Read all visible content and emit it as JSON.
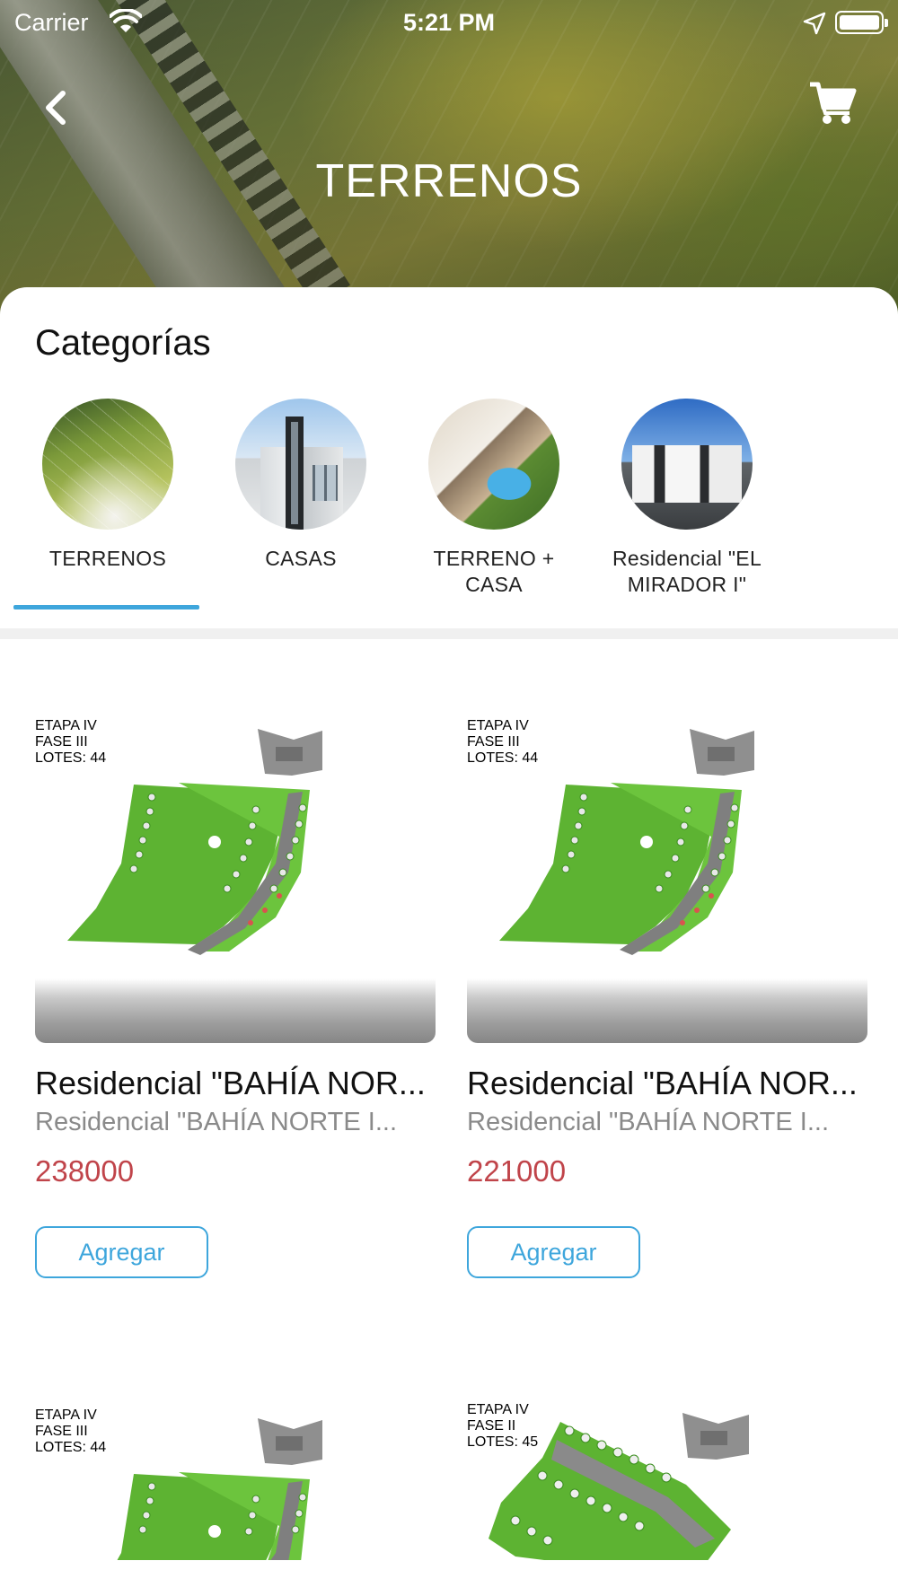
{
  "status_bar": {
    "carrier": "Carrier",
    "time": "5:21 PM"
  },
  "header": {
    "title": "TERRENOS",
    "back_icon": "chevron-left-icon",
    "cart_icon": "cart-icon"
  },
  "categories": {
    "heading": "Categorías",
    "items": [
      {
        "label": "TERRENOS",
        "selected": true
      },
      {
        "label": "CASAS",
        "selected": false
      },
      {
        "label": "TERRENO + CASA",
        "selected": false
      },
      {
        "label": "Residencial \"EL MIRADOR I\"",
        "selected": false
      }
    ],
    "accent_color": "#3ea6dc"
  },
  "products": [
    {
      "name": "Residencial \"BAHÍA NOR...",
      "subtitle": "Residencial \"BAHÍA NORTE I...",
      "price": "238000",
      "button": "Agregar",
      "plan_label": [
        "ETAPA IV",
        "FASE III",
        "LOTES: 44"
      ]
    },
    {
      "name": "Residencial \"BAHÍA NOR...",
      "subtitle": "Residencial \"BAHÍA NORTE I...",
      "price": "221000",
      "button": "Agregar",
      "plan_label": [
        "ETAPA IV",
        "FASE III",
        "LOTES: 44"
      ]
    },
    {
      "plan_label": [
        "ETAPA IV",
        "FASE III",
        "LOTES: 44"
      ]
    },
    {
      "plan_label": [
        "ETAPA IV",
        "FASE II",
        "LOTES: 45"
      ]
    }
  ],
  "colors": {
    "price": "#c0444a",
    "button": "#3ea6dc",
    "subtitle": "#8a8a8a"
  }
}
